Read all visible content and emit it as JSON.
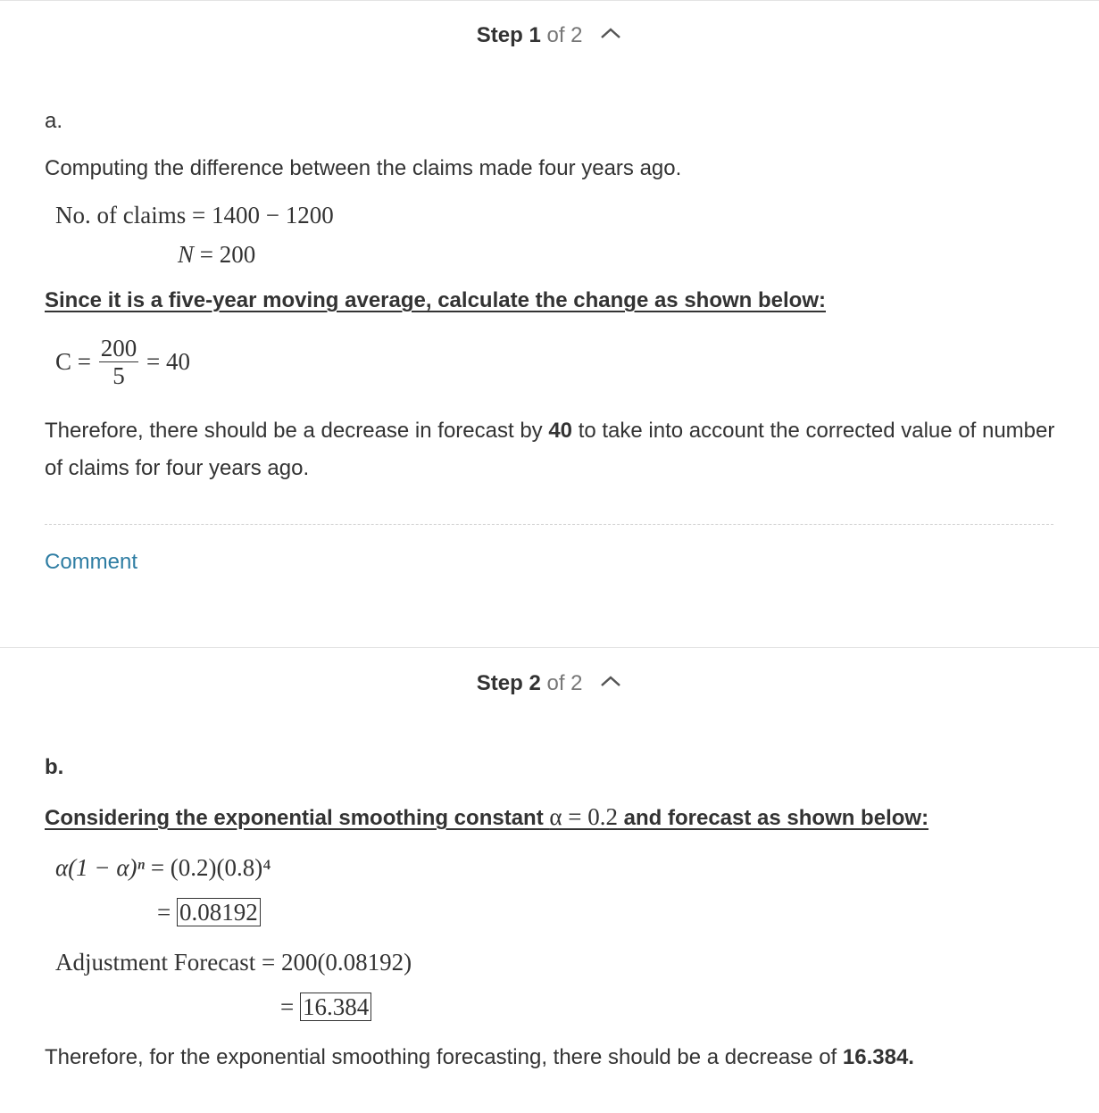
{
  "step1": {
    "label": "Step",
    "number": "1",
    "of_text": "of 2",
    "part": "a.",
    "intro": "Computing the difference between the claims made four years ago.",
    "eq1_lhs": "No. of claims",
    "eq1_rhs": "= 1400 − 1200",
    "eq2_lhs": "N",
    "eq2_rhs": "= 200",
    "heading": "Since it is a five-year moving average, calculate the change as shown below:",
    "frac_lhs": "C =",
    "frac_num": "200",
    "frac_den": "5",
    "frac_rhs": "= 40",
    "conclusion_pre": "Therefore, there should be a decrease in forecast by ",
    "conclusion_bold": "40",
    "conclusion_post": " to take into account the corrected value of number of claims for four years ago.",
    "comment": "Comment"
  },
  "step2": {
    "label": "Step",
    "number": "2",
    "of_text": "of 2",
    "part": "b.",
    "heading_pre": "Considering the exponential smoothing constant ",
    "heading_math": "α = 0.2",
    "heading_post": " and forecast as shown below:",
    "eq1_lhs": "α(1 − α)ⁿ",
    "eq1_rhs": "= (0.2)(0.8)⁴",
    "eq2_eq": "=",
    "eq2_value": "0.08192",
    "eq3_lhs": "Adjustment Forecast",
    "eq3_rhs": "= 200(0.08192)",
    "eq4_eq": "=",
    "eq4_value": "16.384",
    "conclusion_pre": "Therefore, for the exponential smoothing forecasting, there should be a decrease of ",
    "conclusion_bold": "16.384."
  },
  "colors": {
    "link": "#2e7da3",
    "text": "#333333",
    "muted": "#777777",
    "divider": "#e3e3e3"
  },
  "icons": {
    "collapse": "chevron-up-icon"
  }
}
